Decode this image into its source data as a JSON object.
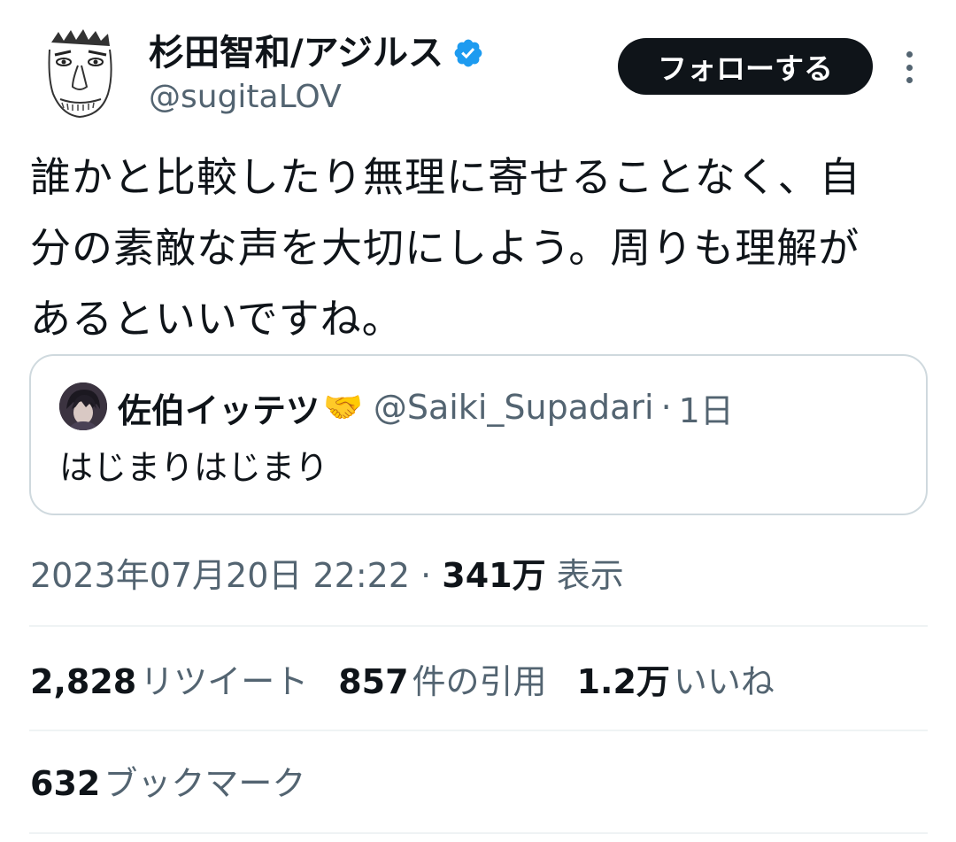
{
  "author": {
    "display_name": "杉田智和/アジルス",
    "handle": "@sugitaLOV",
    "verified": true,
    "avatar_icon": "caricature-face-avatar"
  },
  "actions": {
    "follow_label": "フォローする",
    "more_icon": "more-vertical-icon"
  },
  "tweet": {
    "lines": [
      "誰かと比較したり無理に寄せることなく、自",
      "分の素敵な声を大切にしよう。周りも理解が",
      "あるといいですね。"
    ]
  },
  "quoted_tweet": {
    "display_name": "佐伯イッテツ",
    "emoji": "🤝",
    "handle": "@Saiki_Supadari",
    "separator": "·",
    "time": "1日",
    "text": "はじまりはじまり"
  },
  "meta": {
    "timestamp": "2023年07月20日 22:22",
    "separator": "·",
    "views_count": "341万",
    "views_label": "表示"
  },
  "stats": {
    "retweets_count": "2,828",
    "retweets_label": "リツイート",
    "quotes_count": "857",
    "quotes_label": "件の引用",
    "likes_count": "1.2万",
    "likes_label": "いいね",
    "bookmarks_count": "632",
    "bookmarks_label": "ブックマーク"
  },
  "colors": {
    "text_primary": "#0f1419",
    "text_secondary": "#536471",
    "verified_blue": "#1d9bf0",
    "border": "#cfd9de"
  }
}
